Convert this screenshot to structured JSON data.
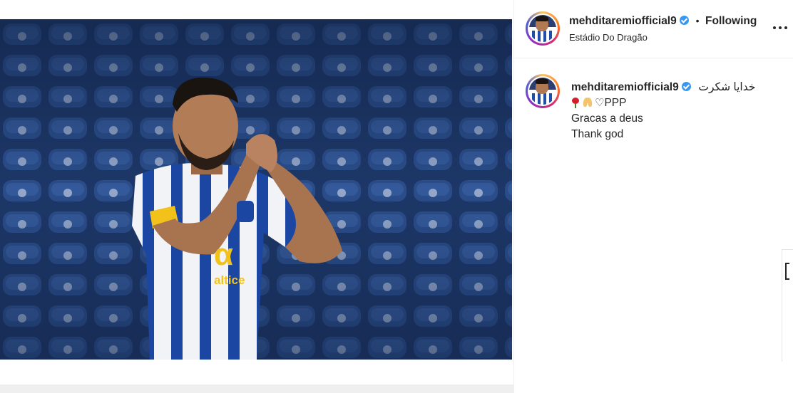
{
  "post": {
    "username": "mehditaremiofficial9",
    "follow_status": "Following",
    "separator": "•",
    "location": "Estádio Do Dragão"
  },
  "caption": {
    "username": "mehditaremiofficial9",
    "arabic_text": "خدایا شکرت",
    "emoji_line_suffix": "PPP",
    "heart_glyph": "♡",
    "line2": "Gracas a deus",
    "line3": "Thank god"
  },
  "icons": {
    "verified": "verified-badge-icon",
    "more": "more-options-icon",
    "rose": "rose-emoji",
    "pray": "praying-hands-emoji",
    "heart": "white-heart-emoji"
  },
  "colors": {
    "verified_blue": "#3897f0",
    "text": "#262626",
    "border": "#efefef"
  }
}
